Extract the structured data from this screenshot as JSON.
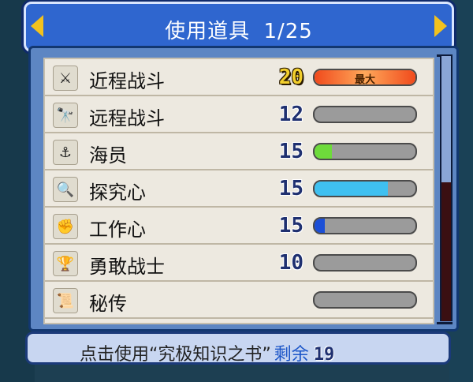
{
  "header": {
    "title": "使用道具",
    "page": "1/25",
    "prev_icon": "arrow-left-icon",
    "next_icon": "arrow-right-icon"
  },
  "stats": [
    {
      "label": "近程战斗",
      "value": "20",
      "level": 1.0,
      "fill_color": "#f26b2a",
      "is_max": true,
      "max_text": "最大",
      "icon": "sword-icon",
      "glyph": "⚔"
    },
    {
      "label": "远程战斗",
      "value": "12",
      "level": 0.0,
      "fill_color": "#9b9b9b",
      "is_max": false,
      "icon": "telescope-icon",
      "glyph": "🔭"
    },
    {
      "label": "海员",
      "value": "15",
      "level": 0.17,
      "fill_color": "#6edb3b",
      "is_max": false,
      "icon": "anchor-icon",
      "glyph": "⚓"
    },
    {
      "label": "探究心",
      "value": "15",
      "level": 0.73,
      "fill_color": "#3fc0f0",
      "is_max": false,
      "icon": "magnifier-icon",
      "glyph": "🔍"
    },
    {
      "label": "工作心",
      "value": "15",
      "level": 0.1,
      "fill_color": "#1c4fd6",
      "is_max": false,
      "icon": "fist-icon",
      "glyph": "✊"
    },
    {
      "label": "勇敢战士",
      "value": "10",
      "level": 0.0,
      "fill_color": "#9b9b9b",
      "is_max": false,
      "icon": "trophy-icon",
      "glyph": "🏆"
    },
    {
      "label": "秘传",
      "value": "",
      "level": 0.0,
      "fill_color": "#9b9b9b",
      "is_max": false,
      "icon": "scroll-icon",
      "glyph": "📜"
    }
  ],
  "footer": {
    "text": "点击使用“究极知识之书”",
    "remain_label": "剩余",
    "remain_count": "19"
  }
}
